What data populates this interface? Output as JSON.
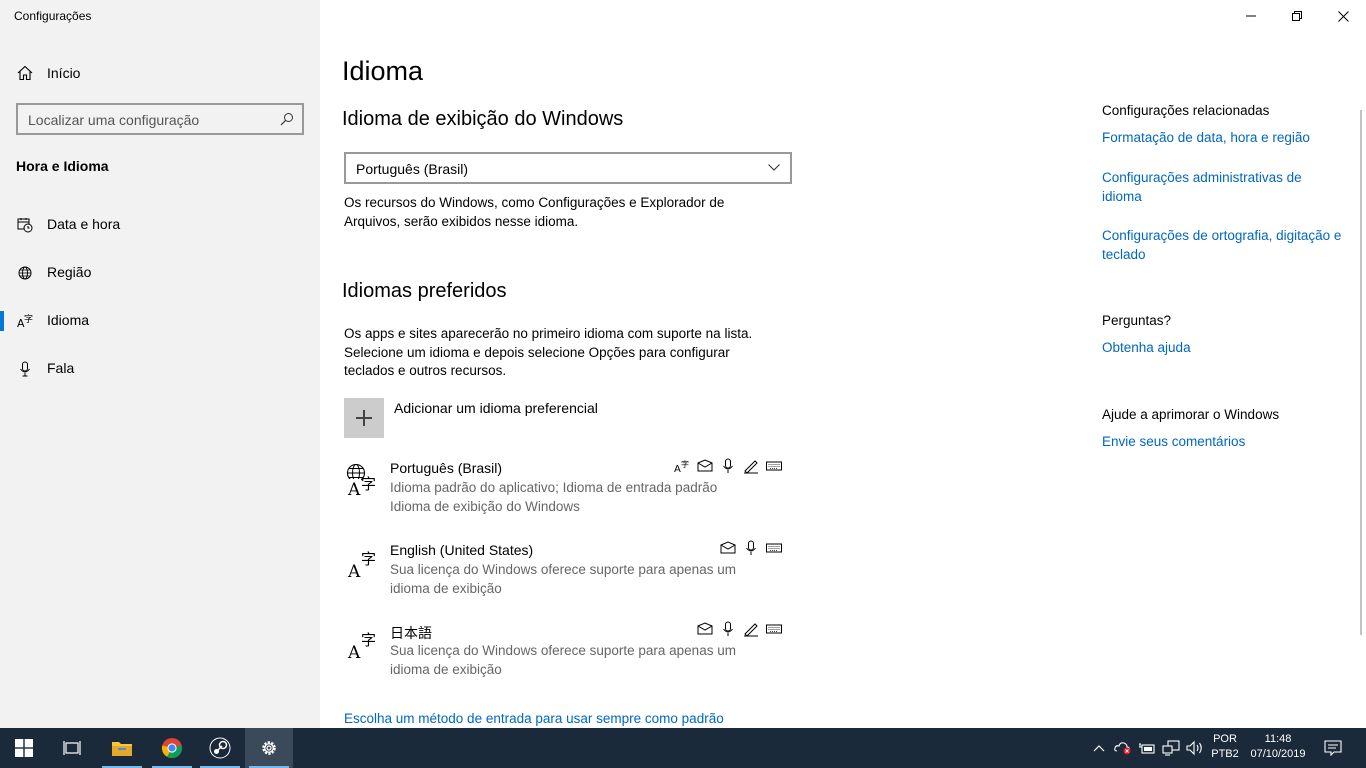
{
  "window": {
    "app_title": "Configurações",
    "controls": {
      "minimize": "—",
      "restore": "❐",
      "close": "✕"
    }
  },
  "sidebar": {
    "home_label": "Início",
    "search_placeholder": "Localizar uma configuração",
    "section_title": "Hora e Idioma",
    "items": [
      {
        "label": "Data e hora",
        "icon": "calendar-clock-icon"
      },
      {
        "label": "Região",
        "icon": "globe-region-icon"
      },
      {
        "label": "Idioma",
        "icon": "language-icon",
        "active": true
      },
      {
        "label": "Fala",
        "icon": "microphone-icon"
      }
    ]
  },
  "main": {
    "title": "Idioma",
    "display_section": {
      "heading": "Idioma de exibição do Windows",
      "dropdown_value": "Português (Brasil)",
      "description": "Os recursos do Windows, como Configurações e Explorador de Arquivos, serão exibidos nesse idioma."
    },
    "preferred_section": {
      "heading": "Idiomas preferidos",
      "description": "Os apps e sites aparecerão no primeiro idioma com suporte na lista. Selecione um idioma e depois selecione Opções para configurar teclados e outros recursos.",
      "add_label": "Adicionar um idioma preferencial",
      "languages": [
        {
          "name": "Português (Brasil)",
          "line1": "Idioma padrão do aplicativo; Idioma de entrada padrão",
          "line2": "Idioma de exibição do Windows"
        },
        {
          "name": "English (United States)",
          "line1": "Sua licença do Windows oferece suporte para apenas um",
          "line2": "idioma de exibição"
        },
        {
          "name": "日本語",
          "line1": "Sua licença do Windows oferece suporte para apenas um",
          "line2": "idioma de exibição"
        }
      ]
    },
    "bottom_link": "Escolha um método de entrada para usar sempre como padrão"
  },
  "related": {
    "heading": "Configurações relacionadas",
    "link1": "Formatação de data, hora e região",
    "link2": "Configurações administrativas de idioma",
    "link3": "Configurações de ortografia, digitação e teclado",
    "questions_heading": "Perguntas?",
    "help_link": "Obtenha ajuda",
    "improve_heading": "Ajude a aprimorar o Windows",
    "feedback_link": "Envie seus comentários"
  },
  "taskbar": {
    "lang_top": "POR",
    "lang_bottom": "PTB2",
    "time": "11:48",
    "date": "07/10/2019"
  },
  "colors": {
    "accent": "#0078d7",
    "link": "#0067c0",
    "sidebar_bg": "#f2f2f2",
    "taskbar_bg": "#1b2a3a"
  }
}
